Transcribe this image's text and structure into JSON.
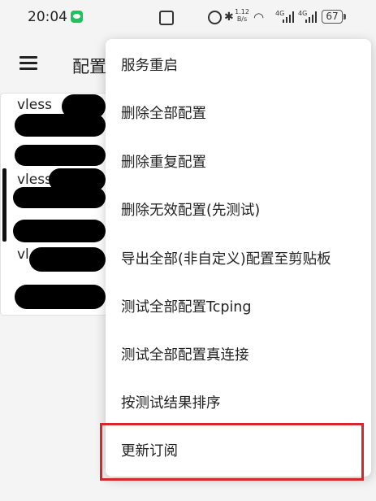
{
  "status_bar": {
    "time": "20:04",
    "net_speed_value": "1.12",
    "net_speed_unit": "B/s",
    "network_1": "4G",
    "network_2": "4G",
    "battery": "67"
  },
  "app_bar": {
    "title": "配置"
  },
  "list": {
    "items": [
      {
        "name": "vless"
      },
      {
        "name": "vless"
      },
      {
        "name": "vl"
      }
    ]
  },
  "menu": {
    "items": [
      {
        "label": "服务重启"
      },
      {
        "label": "删除全部配置"
      },
      {
        "label": "删除重复配置"
      },
      {
        "label": "删除无效配置(先测试)"
      },
      {
        "label": "导出全部(非自定义)配置至剪贴板"
      },
      {
        "label": "测试全部配置Tcping"
      },
      {
        "label": "测试全部配置真连接"
      },
      {
        "label": "按测试结果排序"
      },
      {
        "label": "更新订阅"
      }
    ]
  },
  "colors": {
    "highlight": "#d9262c",
    "wechat": "#1fc05e"
  }
}
